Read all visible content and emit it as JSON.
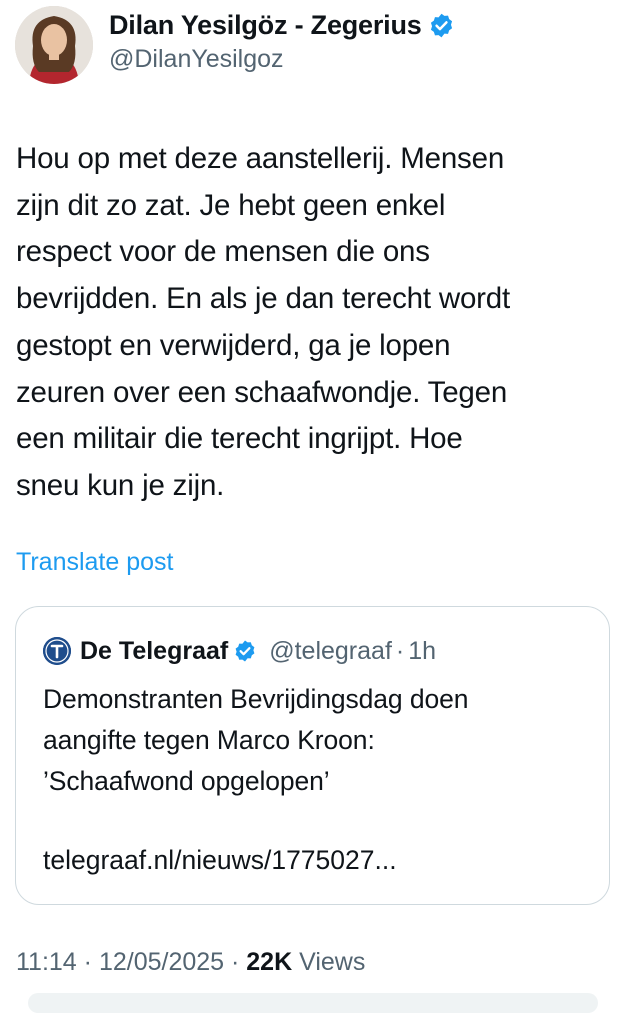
{
  "author": {
    "display_name": "Dilan Yesilgöz - Zegerius",
    "handle": "@DilanYesilgoz",
    "verified": true
  },
  "post": {
    "text_lines": [
      "Hou op met deze aanstellerij. Mensen",
      "zijn dit zo zat. Je hebt geen enkel",
      "respect voor de mensen die ons",
      "bevrijdden. En als je dan terecht wordt",
      "gestopt en verwijderd, ga je lopen",
      "zeuren over een schaafwondje. Tegen",
      "een militair die terecht ingrijpt. Hoe",
      "sneu kun je zijn."
    ],
    "translate_label": "Translate post"
  },
  "quote": {
    "display_name": "De Telegraaf",
    "handle": "@telegraaf",
    "separator": "·",
    "time": "1h",
    "text_lines": [
      "Demonstranten Bevrijdingsdag doen",
      "aangifte tegen Marco Kroon:",
      "’Schaafwond opgelopen’"
    ],
    "link": "telegraaf.nl/nieuws/1775027..."
  },
  "meta": {
    "time": "11:14",
    "sep1": " · ",
    "date": "12/05/2025",
    "sep2": " · ",
    "views_count": "22K",
    "views_label": " Views"
  },
  "colors": {
    "accent": "#1d9bf0",
    "text": "#0f1419",
    "secondary": "#536471",
    "border": "#cfd9de"
  }
}
